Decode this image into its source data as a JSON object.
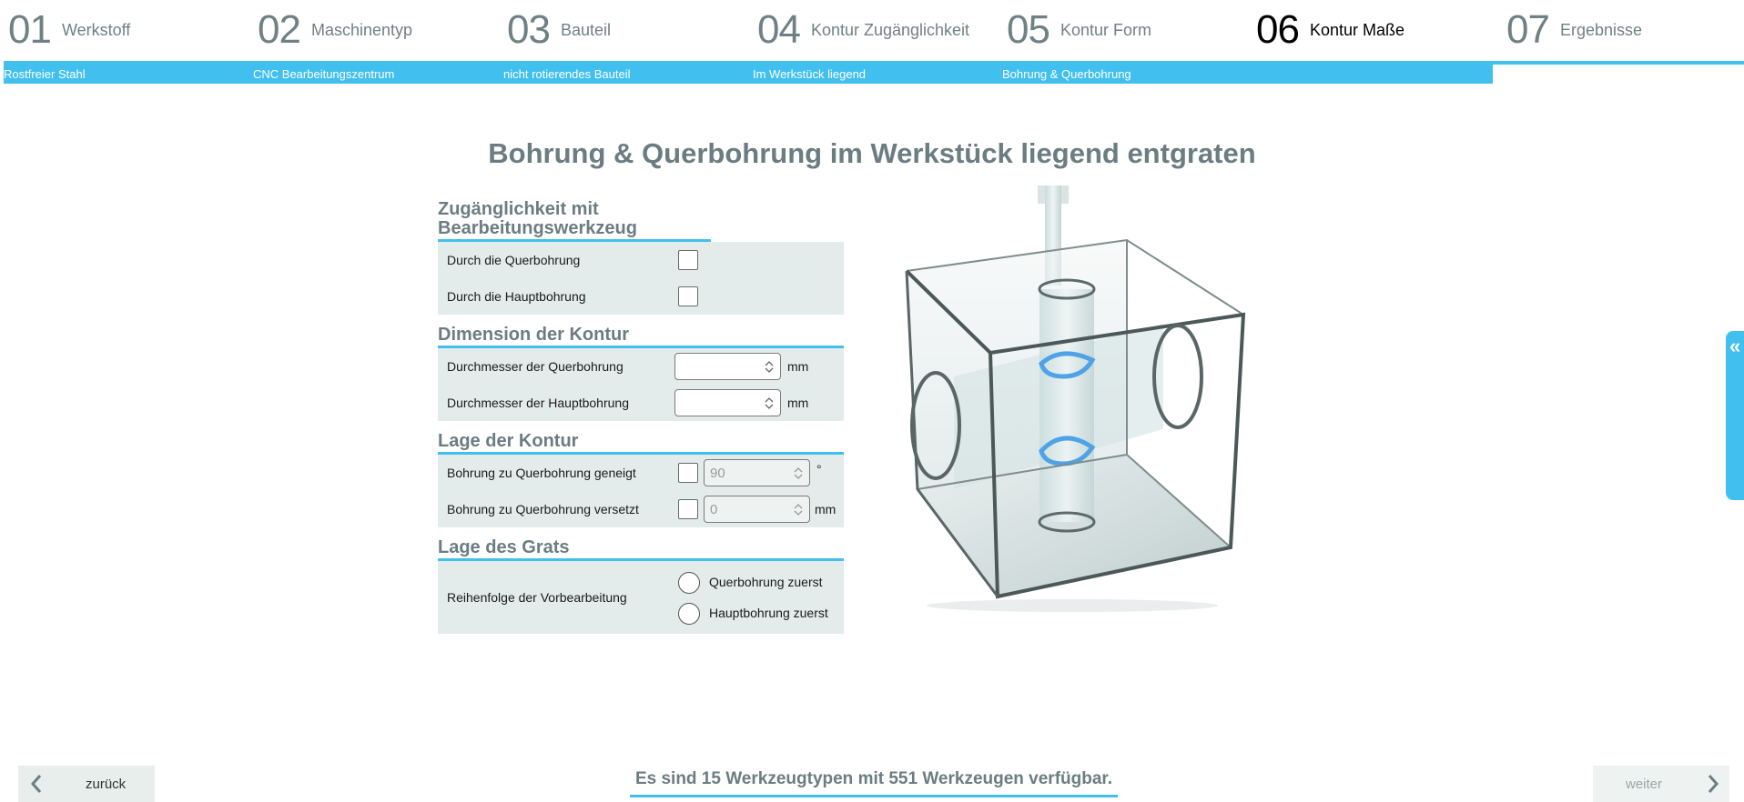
{
  "steps": [
    {
      "num": "01",
      "label": "Werkstoff",
      "crumb": "Rostfreier Stahl"
    },
    {
      "num": "02",
      "label": "Maschinentyp",
      "crumb": "CNC Bearbeitungszentrum"
    },
    {
      "num": "03",
      "label": "Bauteil",
      "crumb": "nicht rotierendes Bauteil"
    },
    {
      "num": "04",
      "label": "Kontur Zugänglichkeit",
      "crumb": "Im Werkstück liegend"
    },
    {
      "num": "05",
      "label": "Kontur Form",
      "crumb": "Bohrung & Querbohrung"
    },
    {
      "num": "06",
      "label": "Kontur Maße",
      "active": true
    },
    {
      "num": "07",
      "label": "Ergebnisse"
    }
  ],
  "title": "Bohrung & Querbohrung im Werkstück liegend entgraten",
  "sections": {
    "access": {
      "title": "Zugänglichkeit mit Bearbeitungswerkzeug",
      "rows": [
        "Durch die Querbohrung",
        "Durch die Hauptbohrung"
      ]
    },
    "dimension": {
      "title": "Dimension der Kontur",
      "rows": [
        {
          "label": "Durchmesser der Querbohrung",
          "unit": "mm",
          "value": ""
        },
        {
          "label": "Durchmesser der Hauptbohrung",
          "unit": "mm",
          "value": ""
        }
      ]
    },
    "position": {
      "title": "Lage der Kontur",
      "rows": [
        {
          "label": "Bohrung zu Querbohrung geneigt",
          "value": "90",
          "unit": "°"
        },
        {
          "label": "Bohrung zu Querbohrung versetzt",
          "value": "0",
          "unit": "mm"
        }
      ]
    },
    "burr": {
      "title": "Lage des Grats",
      "label": "Reihenfolge der Vorbearbeitung",
      "options": [
        "Querbohrung zuerst",
        "Hauptbohrung zuerst"
      ]
    }
  },
  "footer": {
    "back": "zurück",
    "next": "weiter",
    "message": "Es sind 15 Werkzeugtypen mit 551 Werkzeugen verfügbar."
  },
  "colors": {
    "accent": "#41c0ef",
    "panel": "#e3ecea",
    "text": "#6b7d82"
  }
}
